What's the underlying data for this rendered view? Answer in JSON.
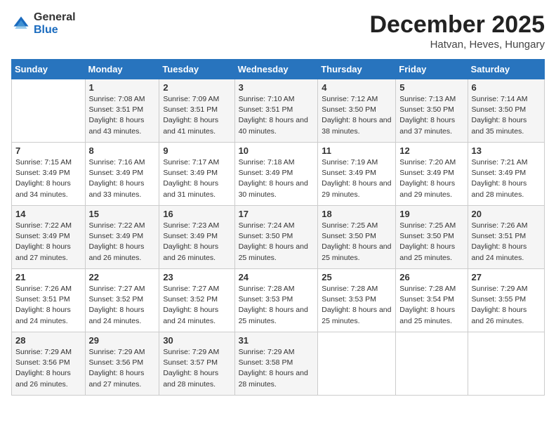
{
  "logo": {
    "general": "General",
    "blue": "Blue"
  },
  "header": {
    "month_year": "December 2025",
    "location": "Hatvan, Heves, Hungary"
  },
  "weekdays": [
    "Sunday",
    "Monday",
    "Tuesday",
    "Wednesday",
    "Thursday",
    "Friday",
    "Saturday"
  ],
  "weeks": [
    [
      {
        "day": "",
        "sunrise": "",
        "sunset": "",
        "daylight": ""
      },
      {
        "day": "1",
        "sunrise": "Sunrise: 7:08 AM",
        "sunset": "Sunset: 3:51 PM",
        "daylight": "Daylight: 8 hours and 43 minutes."
      },
      {
        "day": "2",
        "sunrise": "Sunrise: 7:09 AM",
        "sunset": "Sunset: 3:51 PM",
        "daylight": "Daylight: 8 hours and 41 minutes."
      },
      {
        "day": "3",
        "sunrise": "Sunrise: 7:10 AM",
        "sunset": "Sunset: 3:51 PM",
        "daylight": "Daylight: 8 hours and 40 minutes."
      },
      {
        "day": "4",
        "sunrise": "Sunrise: 7:12 AM",
        "sunset": "Sunset: 3:50 PM",
        "daylight": "Daylight: 8 hours and 38 minutes."
      },
      {
        "day": "5",
        "sunrise": "Sunrise: 7:13 AM",
        "sunset": "Sunset: 3:50 PM",
        "daylight": "Daylight: 8 hours and 37 minutes."
      },
      {
        "day": "6",
        "sunrise": "Sunrise: 7:14 AM",
        "sunset": "Sunset: 3:50 PM",
        "daylight": "Daylight: 8 hours and 35 minutes."
      }
    ],
    [
      {
        "day": "7",
        "sunrise": "Sunrise: 7:15 AM",
        "sunset": "Sunset: 3:49 PM",
        "daylight": "Daylight: 8 hours and 34 minutes."
      },
      {
        "day": "8",
        "sunrise": "Sunrise: 7:16 AM",
        "sunset": "Sunset: 3:49 PM",
        "daylight": "Daylight: 8 hours and 33 minutes."
      },
      {
        "day": "9",
        "sunrise": "Sunrise: 7:17 AM",
        "sunset": "Sunset: 3:49 PM",
        "daylight": "Daylight: 8 hours and 31 minutes."
      },
      {
        "day": "10",
        "sunrise": "Sunrise: 7:18 AM",
        "sunset": "Sunset: 3:49 PM",
        "daylight": "Daylight: 8 hours and 30 minutes."
      },
      {
        "day": "11",
        "sunrise": "Sunrise: 7:19 AM",
        "sunset": "Sunset: 3:49 PM",
        "daylight": "Daylight: 8 hours and 29 minutes."
      },
      {
        "day": "12",
        "sunrise": "Sunrise: 7:20 AM",
        "sunset": "Sunset: 3:49 PM",
        "daylight": "Daylight: 8 hours and 29 minutes."
      },
      {
        "day": "13",
        "sunrise": "Sunrise: 7:21 AM",
        "sunset": "Sunset: 3:49 PM",
        "daylight": "Daylight: 8 hours and 28 minutes."
      }
    ],
    [
      {
        "day": "14",
        "sunrise": "Sunrise: 7:22 AM",
        "sunset": "Sunset: 3:49 PM",
        "daylight": "Daylight: 8 hours and 27 minutes."
      },
      {
        "day": "15",
        "sunrise": "Sunrise: 7:22 AM",
        "sunset": "Sunset: 3:49 PM",
        "daylight": "Daylight: 8 hours and 26 minutes."
      },
      {
        "day": "16",
        "sunrise": "Sunrise: 7:23 AM",
        "sunset": "Sunset: 3:49 PM",
        "daylight": "Daylight: 8 hours and 26 minutes."
      },
      {
        "day": "17",
        "sunrise": "Sunrise: 7:24 AM",
        "sunset": "Sunset: 3:50 PM",
        "daylight": "Daylight: 8 hours and 25 minutes."
      },
      {
        "day": "18",
        "sunrise": "Sunrise: 7:25 AM",
        "sunset": "Sunset: 3:50 PM",
        "daylight": "Daylight: 8 hours and 25 minutes."
      },
      {
        "day": "19",
        "sunrise": "Sunrise: 7:25 AM",
        "sunset": "Sunset: 3:50 PM",
        "daylight": "Daylight: 8 hours and 25 minutes."
      },
      {
        "day": "20",
        "sunrise": "Sunrise: 7:26 AM",
        "sunset": "Sunset: 3:51 PM",
        "daylight": "Daylight: 8 hours and 24 minutes."
      }
    ],
    [
      {
        "day": "21",
        "sunrise": "Sunrise: 7:26 AM",
        "sunset": "Sunset: 3:51 PM",
        "daylight": "Daylight: 8 hours and 24 minutes."
      },
      {
        "day": "22",
        "sunrise": "Sunrise: 7:27 AM",
        "sunset": "Sunset: 3:52 PM",
        "daylight": "Daylight: 8 hours and 24 minutes."
      },
      {
        "day": "23",
        "sunrise": "Sunrise: 7:27 AM",
        "sunset": "Sunset: 3:52 PM",
        "daylight": "Daylight: 8 hours and 24 minutes."
      },
      {
        "day": "24",
        "sunrise": "Sunrise: 7:28 AM",
        "sunset": "Sunset: 3:53 PM",
        "daylight": "Daylight: 8 hours and 25 minutes."
      },
      {
        "day": "25",
        "sunrise": "Sunrise: 7:28 AM",
        "sunset": "Sunset: 3:53 PM",
        "daylight": "Daylight: 8 hours and 25 minutes."
      },
      {
        "day": "26",
        "sunrise": "Sunrise: 7:28 AM",
        "sunset": "Sunset: 3:54 PM",
        "daylight": "Daylight: 8 hours and 25 minutes."
      },
      {
        "day": "27",
        "sunrise": "Sunrise: 7:29 AM",
        "sunset": "Sunset: 3:55 PM",
        "daylight": "Daylight: 8 hours and 26 minutes."
      }
    ],
    [
      {
        "day": "28",
        "sunrise": "Sunrise: 7:29 AM",
        "sunset": "Sunset: 3:56 PM",
        "daylight": "Daylight: 8 hours and 26 minutes."
      },
      {
        "day": "29",
        "sunrise": "Sunrise: 7:29 AM",
        "sunset": "Sunset: 3:56 PM",
        "daylight": "Daylight: 8 hours and 27 minutes."
      },
      {
        "day": "30",
        "sunrise": "Sunrise: 7:29 AM",
        "sunset": "Sunset: 3:57 PM",
        "daylight": "Daylight: 8 hours and 28 minutes."
      },
      {
        "day": "31",
        "sunrise": "Sunrise: 7:29 AM",
        "sunset": "Sunset: 3:58 PM",
        "daylight": "Daylight: 8 hours and 28 minutes."
      },
      {
        "day": "",
        "sunrise": "",
        "sunset": "",
        "daylight": ""
      },
      {
        "day": "",
        "sunrise": "",
        "sunset": "",
        "daylight": ""
      },
      {
        "day": "",
        "sunrise": "",
        "sunset": "",
        "daylight": ""
      }
    ]
  ]
}
